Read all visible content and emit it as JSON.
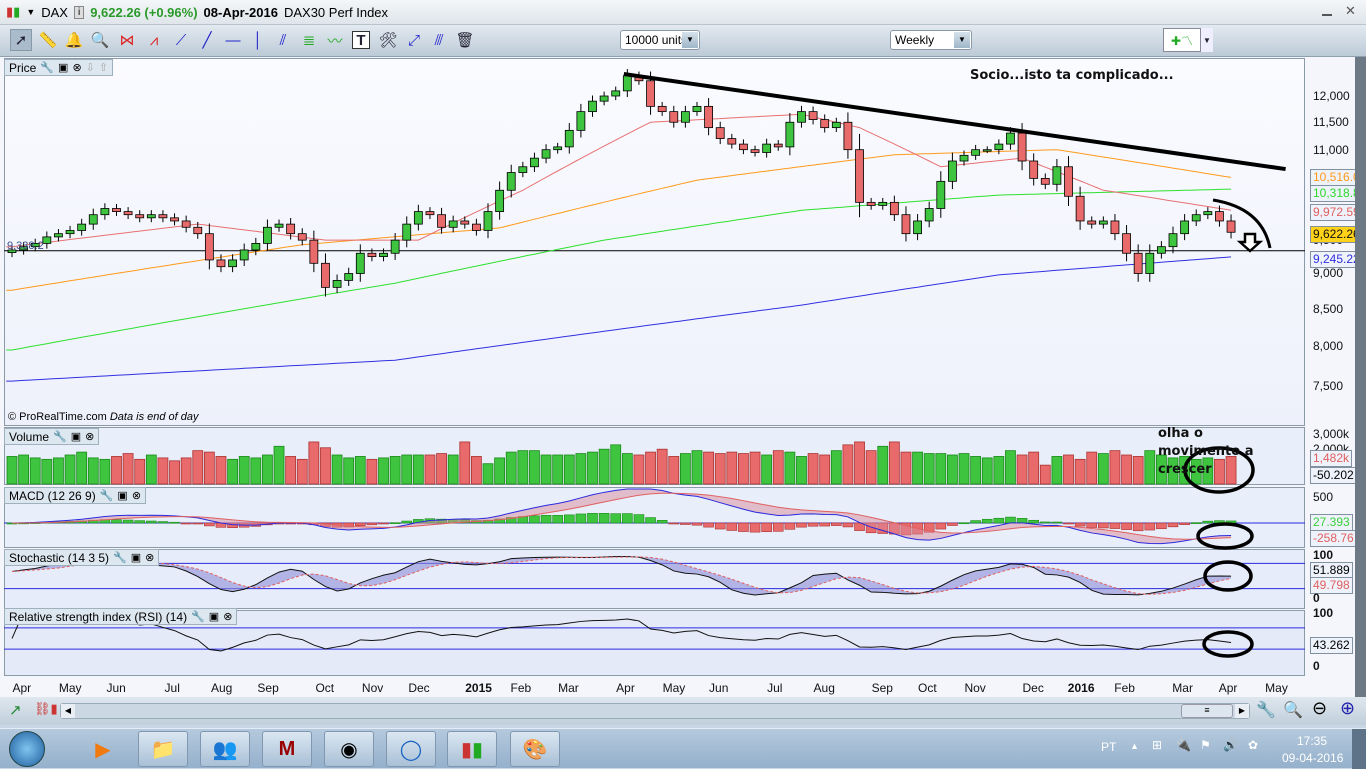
{
  "titlebar": {
    "symbol": "DAX",
    "last": "9,622.26 (+0.96%)",
    "date": "08-Apr-2016",
    "name": "DAX30 Perf Index"
  },
  "toolbar": {
    "units": "10000 units",
    "period": "Weekly"
  },
  "price_pane": {
    "title": "Price",
    "copyright": "© ProRealTime.com",
    "data_note": "Data is end of day",
    "left_label": "9,338.2",
    "ticks": [
      {
        "v": "12,000",
        "p": 12000
      },
      {
        "v": "11,500",
        "p": 11500
      },
      {
        "v": "11,000",
        "p": 11000
      },
      {
        "v": "9,500",
        "p": 9500
      },
      {
        "v": "9,000",
        "p": 9000
      },
      {
        "v": "8,500",
        "p": 8500
      },
      {
        "v": "8,000",
        "p": 8000
      },
      {
        "v": "7,500",
        "p": 7500
      }
    ],
    "value_boxes": {
      "ma_orange": "10,516.04",
      "ma_green": "10,318.81",
      "ma_red": "9,972.59",
      "last": "9,622.26",
      "ma_blue": "9,245.22"
    }
  },
  "volume_pane": {
    "title": "Volume",
    "ticks": [
      "3,000k",
      "2,000k"
    ],
    "value": "1,482k",
    "value2": "-50.202"
  },
  "macd_pane": {
    "title": "MACD (12 26 9)",
    "tick": "500",
    "value_green": "27.393",
    "value_red": "-258.76"
  },
  "stoch_pane": {
    "title": "Stochastic (14 3 5)",
    "tick_top": "100",
    "tick_bottom": "0",
    "k": "51.889",
    "d": "49.798"
  },
  "rsi_pane": {
    "title": "Relative strength index (RSI) (14)",
    "tick_top": "100",
    "tick_bottom": "0",
    "value": "43.262"
  },
  "annotations": {
    "top": "Socio...isto ta complicado...",
    "volume": "olha o movimento a crescer"
  },
  "colors": {
    "up": "#3ec43e",
    "down": "#e86a6a",
    "ma_red": "#e87070",
    "ma_orange": "#ff9a1a",
    "ma_green": "#2ee02e",
    "ma_blue": "#3030e0",
    "last_bg": "#ffd21a"
  },
  "chart_data": {
    "type": "candlestick",
    "title": "DAX30 Perf Index weekly",
    "scale": "log",
    "closes": [
      9350,
      9400,
      9450,
      9550,
      9600,
      9650,
      9750,
      9900,
      10000,
      9950,
      9900,
      9850,
      9900,
      9850,
      9800,
      9700,
      9600,
      9200,
      9100,
      9200,
      9350,
      9450,
      9700,
      9750,
      9600,
      9500,
      9150,
      8800,
      8900,
      9000,
      9300,
      9250,
      9300,
      9500,
      9750,
      9950,
      9900,
      9700,
      9800,
      9750,
      9650,
      9950,
      10300,
      10600,
      10700,
      10850,
      11000,
      11050,
      11350,
      11700,
      11900,
      12000,
      12100,
      12400,
      12300,
      11800,
      11700,
      11500,
      11700,
      11800,
      11400,
      11200,
      11100,
      11000,
      10950,
      11100,
      11050,
      11500,
      11700,
      11550,
      11400,
      11500,
      11000,
      10100,
      10050,
      10100,
      9900,
      9600,
      9800,
      10000,
      10450,
      10800,
      10900,
      11000,
      11000,
      11100,
      11300,
      10800,
      10500,
      10400,
      10700,
      10200,
      9800,
      9750,
      9800,
      9600,
      9300,
      9000,
      9300,
      9400,
      9600,
      9800,
      9900,
      9950,
      9800,
      9622
    ],
    "volumes_k": [
      1900,
      2000,
      1800,
      1700,
      1800,
      2000,
      2200,
      1800,
      1700,
      1900,
      2100,
      1700,
      2000,
      1800,
      1600,
      1800,
      2300,
      2200,
      1900,
      1700,
      1900,
      1800,
      2000,
      2600,
      1900,
      1700,
      2900,
      2500,
      2000,
      1800,
      1900,
      1700,
      1800,
      1900,
      2000,
      2000,
      2000,
      2100,
      2000,
      2900,
      1900,
      1400,
      1800,
      2200,
      2300,
      2300,
      2000,
      2000,
      2000,
      2100,
      2200,
      2400,
      2700,
      2100,
      2000,
      2200,
      2400,
      1900,
      2100,
      2300,
      2200,
      2100,
      2200,
      2100,
      2200,
      2000,
      2300,
      2200,
      1900,
      2100,
      2000,
      2300,
      2700,
      2900,
      2300,
      2600,
      2900,
      2200,
      2200,
      2100,
      2100,
      2000,
      2100,
      1900,
      1800,
      1900,
      2300,
      2000,
      2200,
      1300,
      1900,
      2000,
      1700,
      2200,
      2100,
      2300,
      2000,
      1900,
      2300,
      2000,
      1800,
      1900,
      1700,
      1800,
      1700,
      1900
    ],
    "moving_averages": {
      "red": [
        [
          0,
          9400
        ],
        [
          16,
          9750
        ],
        [
          27,
          9500
        ],
        [
          35,
          9500
        ],
        [
          44,
          10300
        ],
        [
          55,
          11500
        ],
        [
          68,
          11650
        ],
        [
          73,
          11400
        ],
        [
          80,
          10700
        ],
        [
          87,
          10850
        ],
        [
          94,
          10300
        ],
        [
          105,
          9972
        ]
      ],
      "orange": [
        [
          0,
          8760
        ],
        [
          25,
          9430
        ],
        [
          42,
          9690
        ],
        [
          59,
          10470
        ],
        [
          76,
          10910
        ],
        [
          90,
          11000
        ],
        [
          105,
          10516
        ]
      ],
      "green": [
        [
          0,
          7950
        ],
        [
          33,
          8860
        ],
        [
          51,
          9500
        ],
        [
          68,
          9970
        ],
        [
          85,
          10220
        ],
        [
          105,
          10319
        ]
      ],
      "blue": [
        [
          0,
          7560
        ],
        [
          33,
          7820
        ],
        [
          68,
          8550
        ],
        [
          85,
          8980
        ],
        [
          105,
          9245
        ]
      ]
    },
    "trendline": [
      [
        52.7,
        12435
      ],
      [
        109.7,
        10660
      ]
    ],
    "support": 9338,
    "months": [
      {
        "l": "Apr",
        "w": 0.9
      },
      {
        "l": "May",
        "w": 4.9
      },
      {
        "l": "Jun",
        "w": 9
      },
      {
        "l": "Jul",
        "w": 14
      },
      {
        "l": "Aug",
        "w": 18
      },
      {
        "l": "Sep",
        "w": 22
      },
      {
        "l": "Oct",
        "w": 27
      },
      {
        "l": "Nov",
        "w": 31
      },
      {
        "l": "Dec",
        "w": 35
      },
      {
        "l": "2015",
        "w": 39.9,
        "b": 1
      },
      {
        "l": "Feb",
        "w": 43.8
      },
      {
        "l": "Mar",
        "w": 47.9
      },
      {
        "l": "Apr",
        "w": 52.9
      },
      {
        "l": "May",
        "w": 56.9
      },
      {
        "l": "Jun",
        "w": 60.9
      },
      {
        "l": "Jul",
        "w": 65.9
      },
      {
        "l": "Aug",
        "w": 69.9
      },
      {
        "l": "Sep",
        "w": 74.9
      },
      {
        "l": "Oct",
        "w": 78.9
      },
      {
        "l": "Nov",
        "w": 82.9
      },
      {
        "l": "Dec",
        "w": 87.9
      },
      {
        "l": "2016",
        "w": 91.8,
        "b": 1
      },
      {
        "l": "Feb",
        "w": 95.8
      },
      {
        "l": "Mar",
        "w": 100.8
      },
      {
        "l": "Apr",
        "w": 104.8
      },
      {
        "l": "May",
        "w": 108.8
      }
    ]
  },
  "taskbar": {
    "lang": "PT",
    "time": "17:35",
    "date": "09-04-2016"
  }
}
